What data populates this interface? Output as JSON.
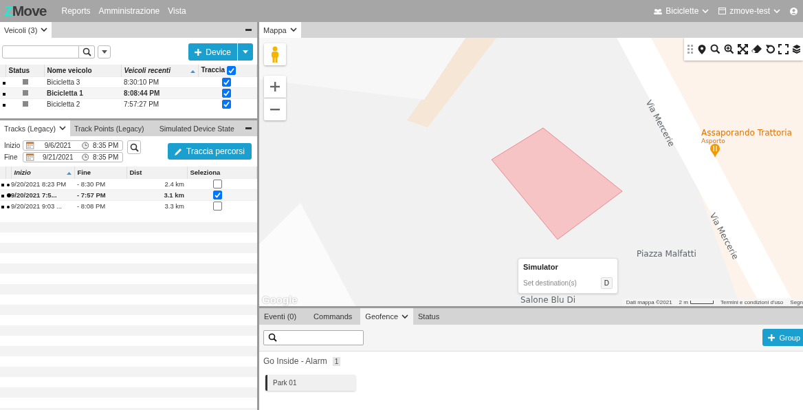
{
  "topbar": {
    "logo": "ZMove",
    "menu": [
      "Reports",
      "Amministrazione",
      "Vista"
    ],
    "group": "Biciclette",
    "account": "zmove-test"
  },
  "vehicles": {
    "tab": "Veicoli (3)",
    "add_button": "Device",
    "track_all": true,
    "columns": [
      {
        "label": "Status",
        "sorted": false
      },
      {
        "label": "Nome veicolo",
        "sorted": false
      },
      {
        "label": "Veicoli recenti",
        "sorted": true
      },
      {
        "label": "Traccia",
        "sorted": false
      }
    ],
    "rows": [
      {
        "name": "Bicicletta 3",
        "time": "8:30:10 PM",
        "selected": false,
        "tracked": true
      },
      {
        "name": "Bicicletta 1",
        "time": "8:08:44 PM",
        "selected": true,
        "tracked": true
      },
      {
        "name": "Bicicletta 2",
        "time": "7:57:27 PM",
        "selected": false,
        "tracked": true
      }
    ]
  },
  "tracks": {
    "tabs": [
      {
        "label": "Tracks (Legacy)",
        "selected": true
      },
      {
        "label": "Track Points (Legacy)",
        "selected": false
      },
      {
        "label": "Simulated Device State",
        "selected": false
      }
    ],
    "start_label": "Inizio",
    "start_date": "9/6/2021",
    "start_time": "8:35 PM",
    "end_label": "Fine",
    "end_date": "9/21/2021",
    "end_time": "8:35 PM",
    "draw_button": "Traccia percorsi",
    "columns": [
      {
        "label": "Inizio",
        "sorted": true
      },
      {
        "label": "Fine",
        "sorted": false
      },
      {
        "label": "Dist",
        "sorted": false
      },
      {
        "label": "Seleziona",
        "sorted": false
      }
    ],
    "rows": [
      {
        "start": "9/20/2021 8:23 PM",
        "end": "- 8:30 PM",
        "dist": "2.4 km",
        "selected": false
      },
      {
        "start": "9/20/2021 7:5...",
        "end": "- 7:57 PM",
        "dist": "3.1 km",
        "selected": true
      },
      {
        "start": "9/20/2021 9:03 ...",
        "end": "- 8:08 PM",
        "dist": "3.3 km",
        "selected": false
      }
    ]
  },
  "map": {
    "tab": "Mappa",
    "labels": [
      {
        "text": "Via Mercerie",
        "kind": "street"
      },
      {
        "text": "Via Mercerie",
        "kind": "street"
      },
      {
        "text": "Assaporando Trattoria",
        "kind": "poi"
      },
      {
        "text": "Asporto",
        "kind": "poi_sub"
      },
      {
        "text": "Piazza Malfatti",
        "kind": "place"
      },
      {
        "text": "Salone Blu Di",
        "kind": "place"
      }
    ],
    "simulator": {
      "title": "Simulator",
      "action": "Set destination(s)",
      "key": "D"
    },
    "provider": "Google",
    "attribution": [
      "Dati mappa ©2021",
      "2 m",
      "Termini e condizioni d'uso",
      "Segn"
    ]
  },
  "bottom": {
    "tabs": [
      {
        "label": "Eventi (0)",
        "selected": false
      },
      {
        "label": "Commands",
        "selected": false
      },
      {
        "label": "Geofence",
        "selected": true
      },
      {
        "label": "Status",
        "selected": false
      }
    ],
    "group_button": "Group",
    "groups": [
      {
        "name": "Go Inside - Alarm",
        "count": "1",
        "items": [
          "Park 01"
        ]
      }
    ]
  }
}
